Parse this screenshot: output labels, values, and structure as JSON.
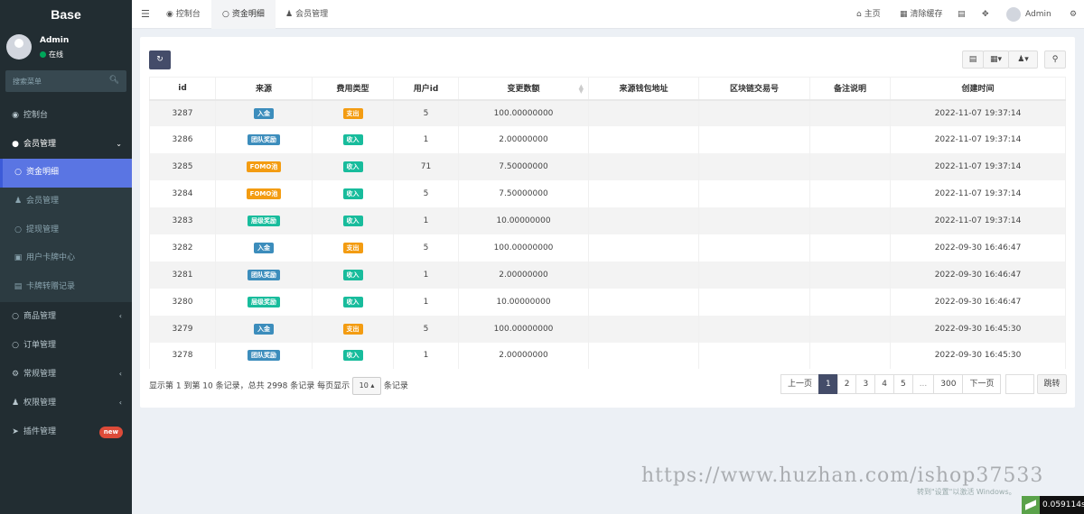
{
  "app": {
    "title": "Base"
  },
  "user": {
    "name": "Admin",
    "status": "在线"
  },
  "search": {
    "placeholder": "搜索菜单"
  },
  "menu": {
    "dashboard": "控制台",
    "member_mgmt": "会员管理",
    "sub": {
      "fund_detail": "资金明细",
      "member_mgmt": "会员管理",
      "withdraw_mgmt": "提现管理",
      "card_center": "用户卡牌中心",
      "card_transfer": "卡牌转赠记录"
    },
    "goods_mgmt": "商品管理",
    "order_mgmt": "订单管理",
    "general_mgmt": "常规管理",
    "perm_mgmt": "权限管理",
    "plugin_mgmt": "插件管理",
    "plugin_badge": "new"
  },
  "topbar": {
    "tabs": [
      "控制台",
      "资金明细",
      "会员管理"
    ],
    "home": "主页",
    "clear_cache": "清除缓存",
    "admin": "Admin"
  },
  "table": {
    "headers": [
      "id",
      "来源",
      "费用类型",
      "用户id",
      "变更数额",
      "来源钱包地址",
      "区块链交易号",
      "备注说明",
      "创建时间"
    ],
    "rows": [
      {
        "id": "3287",
        "source": "入金",
        "source_color": "#3c8dbc",
        "type": "支出",
        "type_color": "#f39c12",
        "uid": "5",
        "amount": "100.00000000",
        "wallet": "",
        "tx": "",
        "note": "",
        "time": "2022-11-07 19:37:14"
      },
      {
        "id": "3286",
        "source": "团队奖励",
        "source_color": "#3c8dbc",
        "type": "收入",
        "type_color": "#18bc9c",
        "uid": "1",
        "amount": "2.00000000",
        "wallet": "",
        "tx": "",
        "note": "",
        "time": "2022-11-07 19:37:14"
      },
      {
        "id": "3285",
        "source": "FOMO池",
        "source_color": "#f39c12",
        "type": "收入",
        "type_color": "#18bc9c",
        "uid": "71",
        "amount": "7.50000000",
        "wallet": "",
        "tx": "",
        "note": "",
        "time": "2022-11-07 19:37:14"
      },
      {
        "id": "3284",
        "source": "FOMO池",
        "source_color": "#f39c12",
        "type": "收入",
        "type_color": "#18bc9c",
        "uid": "5",
        "amount": "7.50000000",
        "wallet": "",
        "tx": "",
        "note": "",
        "time": "2022-11-07 19:37:14"
      },
      {
        "id": "3283",
        "source": "层级奖励",
        "source_color": "#18bc9c",
        "type": "收入",
        "type_color": "#18bc9c",
        "uid": "1",
        "amount": "10.00000000",
        "wallet": "",
        "tx": "",
        "note": "",
        "time": "2022-11-07 19:37:14"
      },
      {
        "id": "3282",
        "source": "入金",
        "source_color": "#3c8dbc",
        "type": "支出",
        "type_color": "#f39c12",
        "uid": "5",
        "amount": "100.00000000",
        "wallet": "",
        "tx": "",
        "note": "",
        "time": "2022-09-30 16:46:47"
      },
      {
        "id": "3281",
        "source": "团队奖励",
        "source_color": "#3c8dbc",
        "type": "收入",
        "type_color": "#18bc9c",
        "uid": "1",
        "amount": "2.00000000",
        "wallet": "",
        "tx": "",
        "note": "",
        "time": "2022-09-30 16:46:47"
      },
      {
        "id": "3280",
        "source": "层级奖励",
        "source_color": "#18bc9c",
        "type": "收入",
        "type_color": "#18bc9c",
        "uid": "1",
        "amount": "10.00000000",
        "wallet": "",
        "tx": "",
        "note": "",
        "time": "2022-09-30 16:46:47"
      },
      {
        "id": "3279",
        "source": "入金",
        "source_color": "#3c8dbc",
        "type": "支出",
        "type_color": "#f39c12",
        "uid": "5",
        "amount": "100.00000000",
        "wallet": "",
        "tx": "",
        "note": "",
        "time": "2022-09-30 16:45:30"
      },
      {
        "id": "3278",
        "source": "团队奖励",
        "source_color": "#3c8dbc",
        "type": "收入",
        "type_color": "#18bc9c",
        "uid": "1",
        "amount": "2.00000000",
        "wallet": "",
        "tx": "",
        "note": "",
        "time": "2022-09-30 16:45:30"
      }
    ]
  },
  "footer": {
    "summary": "显示第 1 到第 10 条记录，总共 2998 条记录 每页显示",
    "page_size": "10",
    "per_page_suffix": "条记录"
  },
  "pager": {
    "prev": "上一页",
    "pages": [
      "1",
      "2",
      "3",
      "4",
      "5",
      "...",
      "300"
    ],
    "next": "下一页",
    "jump": "跳转"
  },
  "overlay": {
    "watermark": "https://www.huzhan.com/ishop37533",
    "windows_activation": "转到\"设置\"以激活 Windows。",
    "timer": "0.059114s"
  },
  "colors": {
    "sidebar": "#222d32",
    "active": "#5a75e3",
    "primary": "#444c69"
  }
}
